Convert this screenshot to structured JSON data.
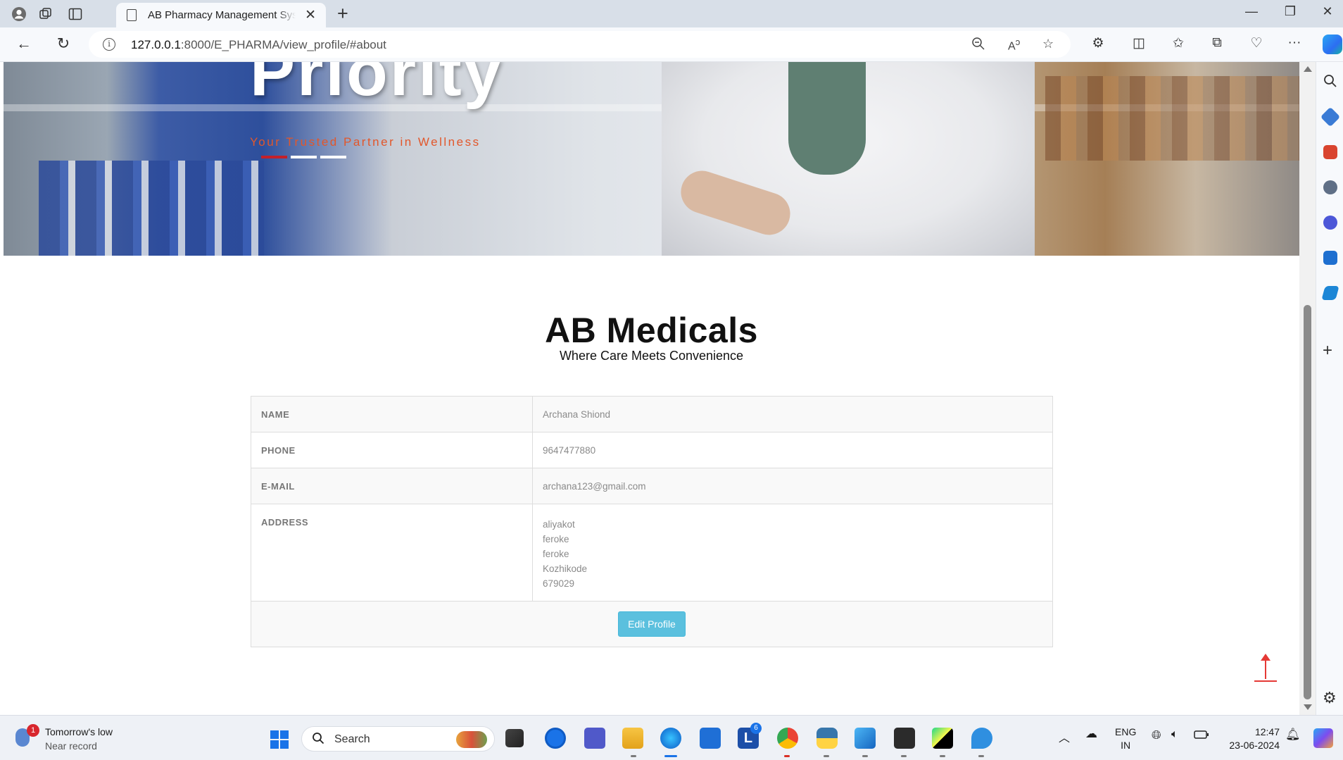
{
  "browser": {
    "tab_title": "AB Pharmacy Management System",
    "url_host": "127.0.0.1",
    "url_path": ":8000/E_PHARMA/view_profile/#about"
  },
  "hero": {
    "title": "Priority",
    "subtitle": "Your Trusted Partner in Wellness"
  },
  "brand": {
    "name": "AB Medicals",
    "tagline": "Where Care Meets Convenience"
  },
  "profile": {
    "name_label": "NAME",
    "name_value": "Archana Shiond",
    "phone_label": "PHONE",
    "phone_value": "9647477880",
    "email_label": "E-MAIL",
    "email_value": "archana123@gmail.com",
    "address_label": "ADDRESS",
    "address_lines": [
      "aliyakot",
      "feroke",
      "feroke",
      "Kozhikode",
      "679029"
    ],
    "edit_button": "Edit Profile"
  },
  "taskbar": {
    "weather_title": "Tomorrow's low",
    "weather_sub": "Near record",
    "weather_badge": "1",
    "search_label": "Search",
    "lang_top": "ENG",
    "lang_bottom": "IN",
    "time": "12:47",
    "date": "23-06-2024",
    "l_app_badge": "6"
  },
  "colors": {
    "accent_button": "#5bc0de",
    "hero_subtitle": "#e2572b",
    "back_to_top": "#e53935"
  }
}
